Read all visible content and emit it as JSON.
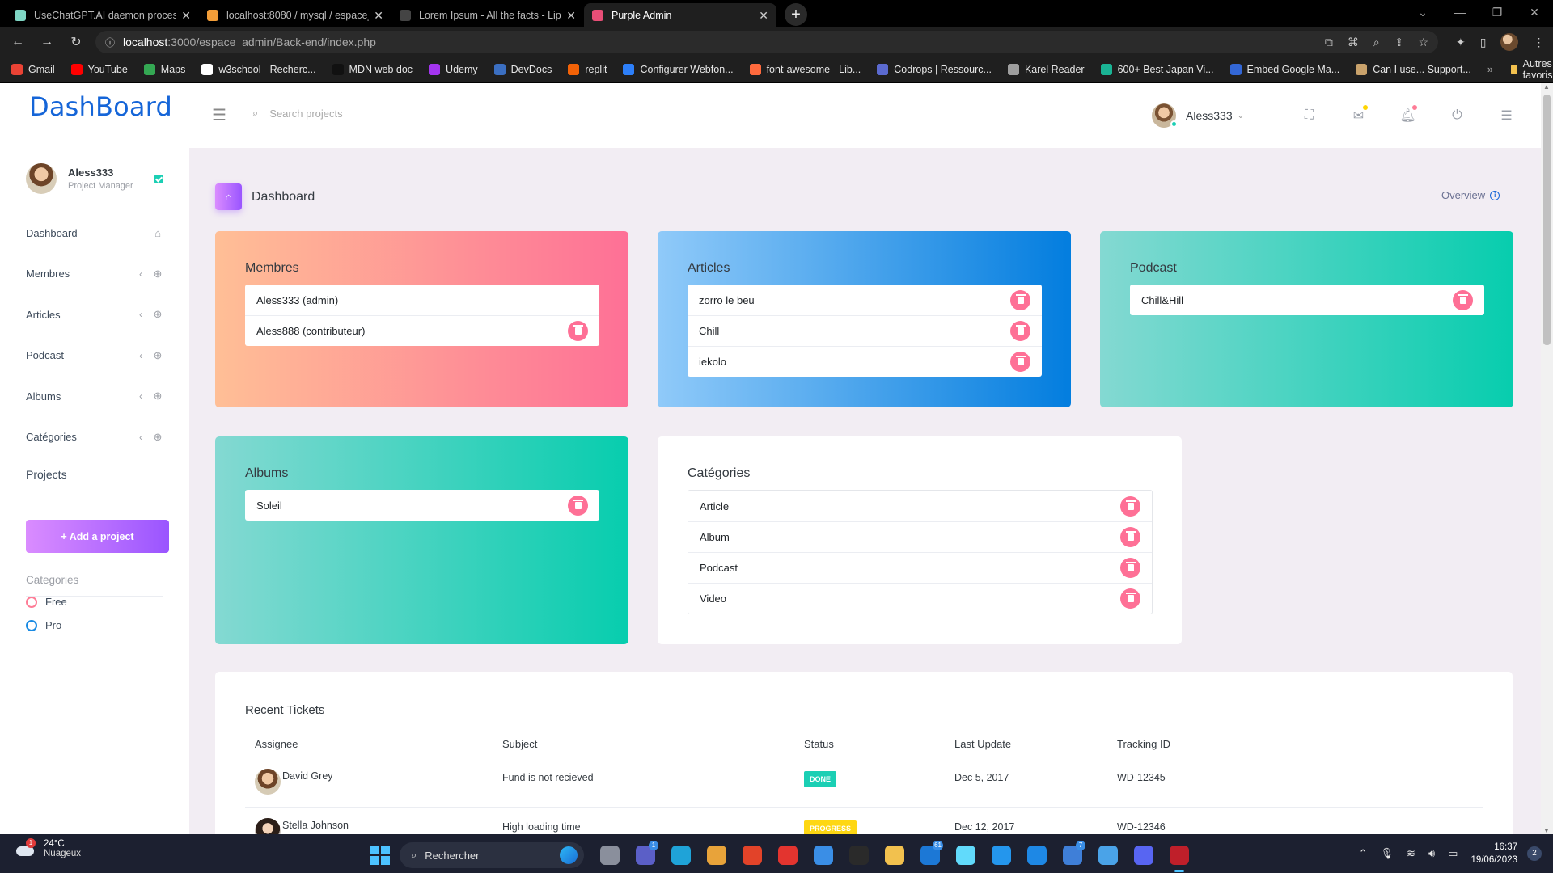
{
  "browser": {
    "tabs": [
      {
        "label": "UseChatGPT.AI daemon process",
        "color": "#7fd6c4",
        "active": false
      },
      {
        "label": "localhost:8080 / mysql / espace_",
        "color": "#f29d38",
        "active": false
      },
      {
        "label": "Lorem Ipsum - All the facts - Lip",
        "color": "#444444",
        "active": false
      },
      {
        "label": "Purple Admin",
        "color": "#e94e77",
        "active": true
      }
    ],
    "url_host": "localhost",
    "url_path": ":3000/espace_admin/Back-end/index.php",
    "bookmarks": [
      {
        "label": "Gmail",
        "color": "#ea4335"
      },
      {
        "label": "YouTube",
        "color": "#ff0000"
      },
      {
        "label": "Maps",
        "color": "#34a853"
      },
      {
        "label": "w3school - Recherc...",
        "color": "#ffffff"
      },
      {
        "label": "MDN web doc",
        "color": "#111111"
      },
      {
        "label": "Udemy",
        "color": "#a435f0"
      },
      {
        "label": "DevDocs",
        "color": "#3b6fc2"
      },
      {
        "label": "replit",
        "color": "#f26207"
      },
      {
        "label": "Configurer Webfon...",
        "color": "#2d7ff9"
      },
      {
        "label": "font-awesome - Lib...",
        "color": "#ff6a3d"
      },
      {
        "label": "Codrops | Ressourc...",
        "color": "#5b6ad0"
      },
      {
        "label": "Karel Reader",
        "color": "#9e9e9e"
      },
      {
        "label": "600+ Best Japan Vi...",
        "color": "#1ab394"
      },
      {
        "label": "Embed Google Ma...",
        "color": "#3367d6"
      },
      {
        "label": "Can I use... Support...",
        "color": "#c9a26b"
      }
    ],
    "other_bookmarks": "Autres favoris"
  },
  "navbar": {
    "brand": "DashBoard",
    "search_placeholder": "Search projects",
    "user_name": "Aless333"
  },
  "sidebar": {
    "profile_name": "Aless333",
    "profile_role": "Project Manager",
    "items": [
      {
        "label": "Dashboard",
        "icon": "home-icon",
        "has_arrow": false
      },
      {
        "label": "Membres",
        "icon": "crosshair-icon",
        "has_arrow": true
      },
      {
        "label": "Articles",
        "icon": "crosshair-icon",
        "has_arrow": true
      },
      {
        "label": "Podcast",
        "icon": "crosshair-icon",
        "has_arrow": true
      },
      {
        "label": "Albums",
        "icon": "crosshair-icon",
        "has_arrow": true
      },
      {
        "label": "Catégories",
        "icon": "crosshair-icon",
        "has_arrow": true
      }
    ],
    "projects_title": "Projects",
    "add_project_label": "+ Add a project",
    "categories_title": "Categories",
    "categories": [
      {
        "label": "Free",
        "color": "#fe7c96"
      },
      {
        "label": "Pro",
        "color": "#198ae3"
      }
    ]
  },
  "page": {
    "title": "Dashboard",
    "overview": "Overview"
  },
  "cards": {
    "membres": {
      "title": "Membres",
      "items": [
        {
          "label": "Aless333 (admin)",
          "deletable": false
        },
        {
          "label": "Aless888 (contributeur)",
          "deletable": true
        }
      ]
    },
    "articles": {
      "title": "Articles",
      "items": [
        {
          "label": "zorro le beu",
          "deletable": true
        },
        {
          "label": "Chill",
          "deletable": true
        },
        {
          "label": "iekolo",
          "deletable": true
        }
      ]
    },
    "podcast": {
      "title": "Podcast",
      "items": [
        {
          "label": "Chill&Hill",
          "deletable": true
        }
      ]
    },
    "albums": {
      "title": "Albums",
      "items": [
        {
          "label": "Soleil",
          "deletable": true
        }
      ]
    },
    "categories": {
      "title": "Catégories",
      "items": [
        {
          "label": "Article",
          "deletable": true
        },
        {
          "label": "Album",
          "deletable": true
        },
        {
          "label": "Podcast",
          "deletable": true
        },
        {
          "label": "Video",
          "deletable": true
        }
      ]
    }
  },
  "tickets": {
    "title": "Recent Tickets",
    "headers": [
      "Assignee",
      "Subject",
      "Status",
      "Last Update",
      "Tracking ID"
    ],
    "rows": [
      {
        "assignee": "David Grey",
        "subject": "Fund is not recieved",
        "status": "DONE",
        "status_color": "#1bcfb4",
        "updated": "Dec 5, 2017",
        "tracking": "WD-12345"
      },
      {
        "assignee": "Stella Johnson",
        "subject": "High loading time",
        "status": "PROGRESS",
        "status_color": "#fed713",
        "updated": "Dec 12, 2017",
        "tracking": "WD-12346"
      }
    ]
  },
  "taskbar": {
    "temperature": "24°C",
    "weather": "Nuageux",
    "weather_badge": "1",
    "search_label": "Rechercher",
    "time": "16:37",
    "date": "19/06/2023",
    "notifications": "2",
    "apps": [
      {
        "name": "task-view-icon",
        "color": "#8a8f9c",
        "badge": ""
      },
      {
        "name": "teams-icon",
        "color": "#5b5fc7",
        "badge": "1"
      },
      {
        "name": "edge-icon",
        "color": "#1fa3d8",
        "badge": ""
      },
      {
        "name": "chrome-icon",
        "color": "#e8a33a",
        "badge": ""
      },
      {
        "name": "git-icon",
        "color": "#e24329",
        "badge": ""
      },
      {
        "name": "chromium-icon",
        "color": "#e3342f",
        "badge": ""
      },
      {
        "name": "chat-icon",
        "color": "#3a8ee6",
        "badge": ""
      },
      {
        "name": "camera-icon",
        "color": "#2a2a2a",
        "badge": ""
      },
      {
        "name": "explorer-icon",
        "color": "#f2c14e",
        "badge": ""
      },
      {
        "name": "mail-icon",
        "color": "#1c78d6",
        "badge": "61"
      },
      {
        "name": "react-icon",
        "color": "#61dafb",
        "badge": ""
      },
      {
        "name": "docker-icon",
        "color": "#2496ed",
        "badge": ""
      },
      {
        "name": "vscode-icon",
        "color": "#1e88e5",
        "badge": ""
      },
      {
        "name": "todo-icon",
        "color": "#3f7fd8",
        "badge": "7"
      },
      {
        "name": "docker-desktop-icon",
        "color": "#4aa3e8",
        "badge": ""
      },
      {
        "name": "discord-icon",
        "color": "#5865f2",
        "badge": ""
      },
      {
        "name": "filezilla-icon",
        "color": "#bf1f2a",
        "badge": ""
      }
    ]
  }
}
